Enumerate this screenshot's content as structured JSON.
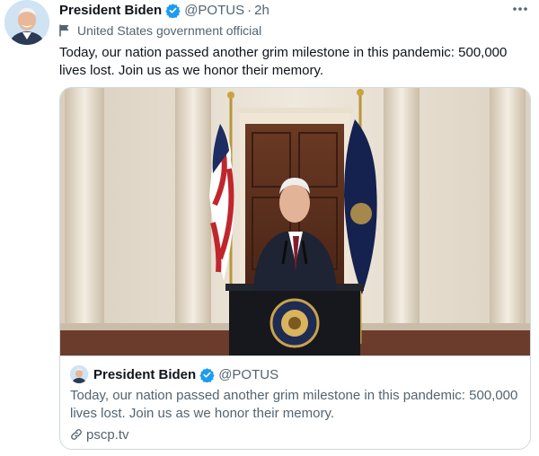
{
  "tweet": {
    "author_name": "President Biden",
    "handle": "@POTUS",
    "separator": "·",
    "time": "2h",
    "account_label": "United States government official",
    "text": "Today, our nation passed another grim milestone in this pandemic: 500,000 lives lost. Join us as we honor their memory.",
    "more_icon": "more-horizontal-icon",
    "verified_icon": "verified-badge-icon",
    "flag_icon": "flag-icon"
  },
  "card": {
    "author_name": "President Biden",
    "handle": "@POTUS",
    "text": "Today, our nation passed another grim milestone in this pandemic: 500,000 lives lost. Join us as we honor their memory.",
    "link": "pscp.tv",
    "link_icon": "link-icon"
  },
  "colors": {
    "text_primary": "#0f1419",
    "text_secondary": "#536471",
    "verified_blue": "#1d9bf0",
    "border": "#cfd9de"
  }
}
